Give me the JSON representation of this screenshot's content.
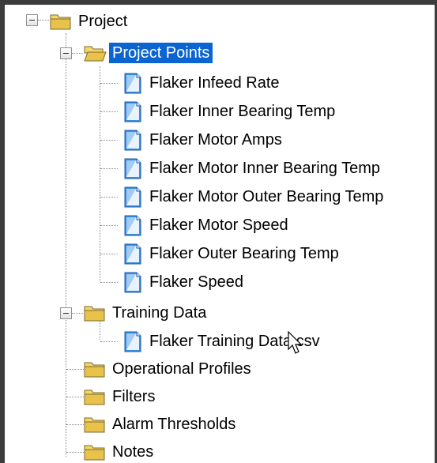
{
  "tree": {
    "root": {
      "label": "Project",
      "icon": "folder-icon",
      "expanded": true
    },
    "project_points": {
      "label": "Project Points",
      "icon": "folder-open-icon",
      "expanded": true,
      "selected": true,
      "items": [
        "Flaker Infeed Rate",
        "Flaker Inner Bearing Temp",
        "Flaker Motor Amps",
        "Flaker Motor Inner Bearing Temp",
        "Flaker Motor Outer Bearing Temp",
        "Flaker Motor Speed",
        "Flaker Outer Bearing Temp",
        "Flaker Speed"
      ]
    },
    "training_data": {
      "label": "Training Data",
      "icon": "folder-icon",
      "expanded": true,
      "items": [
        "Flaker Training Data.csv"
      ]
    },
    "other_folders": [
      "Operational Profiles",
      "Filters",
      "Alarm Thresholds",
      "Notes"
    ]
  },
  "colors": {
    "selection": "#0a64d2",
    "folder": "#f5d66b",
    "document": "#3b8ee0",
    "background": "#ffffff",
    "border": "#3c3c3c"
  }
}
